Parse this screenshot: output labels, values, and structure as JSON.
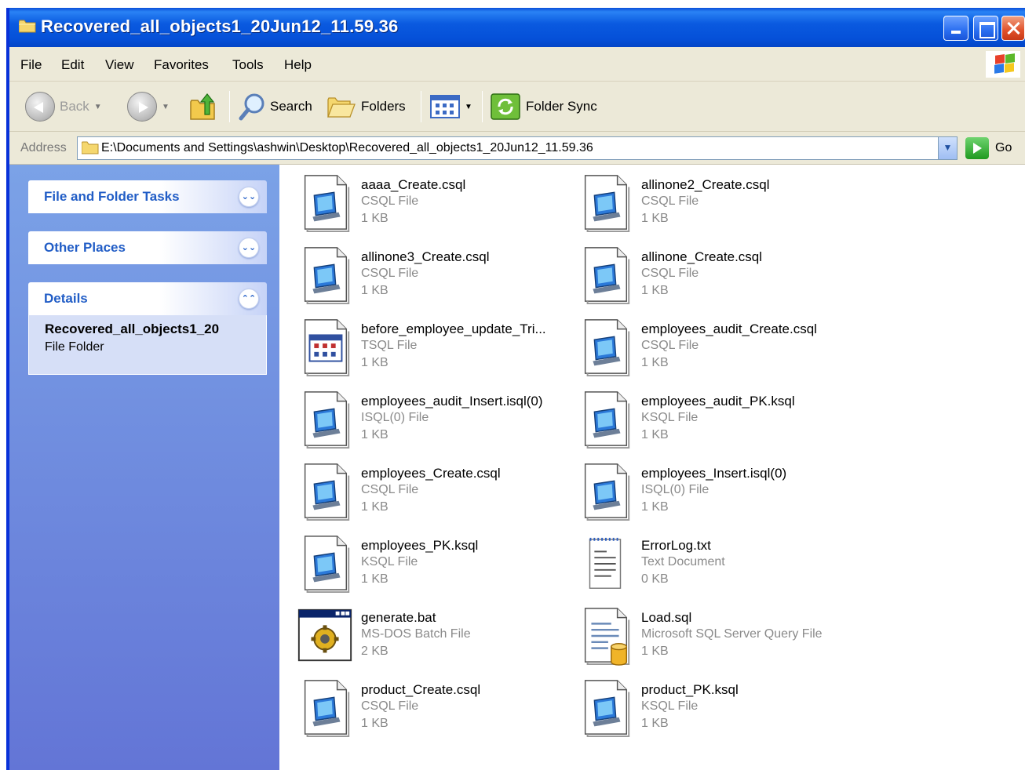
{
  "window": {
    "title": "Recovered_all_objects1_20Jun12_11.59.36"
  },
  "menu": [
    "File",
    "Edit",
    "View",
    "Favorites",
    "Tools",
    "Help"
  ],
  "toolbar": {
    "back_label": "Back",
    "search_label": "Search",
    "folders_label": "Folders",
    "folder_sync_label": "Folder Sync"
  },
  "address": {
    "label": "Address",
    "value": "E:\\Documents and Settings\\ashwin\\Desktop\\Recovered_all_objects1_20Jun12_11.59.36",
    "go_label": "Go"
  },
  "taskpane": {
    "file_tasks_title": "File and Folder Tasks",
    "other_places_title": "Other Places",
    "details_title": "Details",
    "details_name": "Recovered_all_objects1_20",
    "details_type": "File Folder"
  },
  "files": [
    {
      "name": "aaaa_Create.csql",
      "type": "CSQL File",
      "size": "1 KB",
      "icon": "sql-script-icon"
    },
    {
      "name": "allinone2_Create.csql",
      "type": "CSQL File",
      "size": "1 KB",
      "icon": "sql-script-icon"
    },
    {
      "name": "allinone3_Create.csql",
      "type": "CSQL File",
      "size": "1 KB",
      "icon": "sql-script-icon"
    },
    {
      "name": "allinone_Create.csql",
      "type": "CSQL File",
      "size": "1 KB",
      "icon": "sql-script-icon"
    },
    {
      "name": "before_employee_update_Tri...",
      "type": "TSQL File",
      "size": "1 KB",
      "icon": "tsql-file-icon"
    },
    {
      "name": "employees_audit_Create.csql",
      "type": "CSQL File",
      "size": "1 KB",
      "icon": "sql-script-icon"
    },
    {
      "name": "employees_audit_Insert.isql(0)",
      "type": "ISQL(0) File",
      "size": "1 KB",
      "icon": "sql-script-icon"
    },
    {
      "name": "employees_audit_PK.ksql",
      "type": "KSQL File",
      "size": "1 KB",
      "icon": "sql-script-icon"
    },
    {
      "name": "employees_Create.csql",
      "type": "CSQL File",
      "size": "1 KB",
      "icon": "sql-script-icon"
    },
    {
      "name": "employees_Insert.isql(0)",
      "type": "ISQL(0) File",
      "size": "1 KB",
      "icon": "sql-script-icon"
    },
    {
      "name": "employees_PK.ksql",
      "type": "KSQL File",
      "size": "1 KB",
      "icon": "sql-script-icon"
    },
    {
      "name": "ErrorLog.txt",
      "type": "Text Document",
      "size": "0 KB",
      "icon": "text-document-icon"
    },
    {
      "name": "generate.bat",
      "type": "MS-DOS Batch File",
      "size": "2 KB",
      "icon": "batch-file-icon"
    },
    {
      "name": "Load.sql",
      "type": "Microsoft SQL Server Query File",
      "size": "1 KB",
      "icon": "sql-query-icon"
    },
    {
      "name": "product_Create.csql",
      "type": "CSQL File",
      "size": "1 KB",
      "icon": "sql-script-icon"
    },
    {
      "name": "product_PK.ksql",
      "type": "KSQL File",
      "size": "1 KB",
      "icon": "sql-script-icon"
    }
  ],
  "colors": {
    "titlebar": "#0a5ae0",
    "taskpane_top": "#7ba2e7",
    "taskpane_bottom": "#6375d6",
    "panel_title": "#215dc6",
    "chrome": "#ece9d8"
  }
}
